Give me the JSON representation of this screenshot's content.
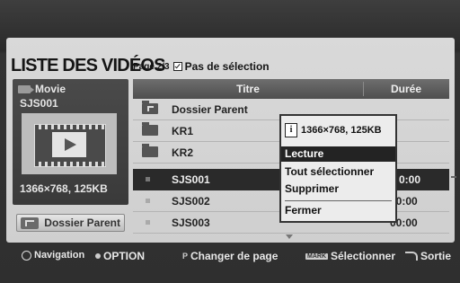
{
  "header": {
    "title": "LISTE DES VIDÉOS",
    "page": "Page 2/3",
    "selection": "Pas de sélection"
  },
  "preview": {
    "label": "Movie",
    "name": "SJS001",
    "resolution": "1366×768, 125KB"
  },
  "parent_button": "Dossier Parent",
  "columns": {
    "title": "Titre",
    "duration": "Durée"
  },
  "rows": [
    {
      "name": "Dossier Parent",
      "duration": ""
    },
    {
      "name": "KR1",
      "duration": ""
    },
    {
      "name": "KR2",
      "duration": ""
    },
    {
      "name": "SJS001",
      "duration": "0:00"
    },
    {
      "name": "SJS002",
      "duration": "00:00"
    },
    {
      "name": "SJS003",
      "duration": "00:00"
    }
  ],
  "popup": {
    "info": "1366×768, 125KB",
    "items": [
      "Lecture",
      "Tout sélectionner",
      "Supprimer",
      "Fermer"
    ]
  },
  "footer": {
    "navigation": "Navigation",
    "option": "OPTION",
    "page_change": "Changer de page",
    "mark": "MARK",
    "select": "Sélectionner",
    "exit": "Sortie"
  },
  "colors": {
    "selected_row": "#2a2a2a",
    "panel": "#d4d4d4",
    "background": "#2f2f2f"
  }
}
